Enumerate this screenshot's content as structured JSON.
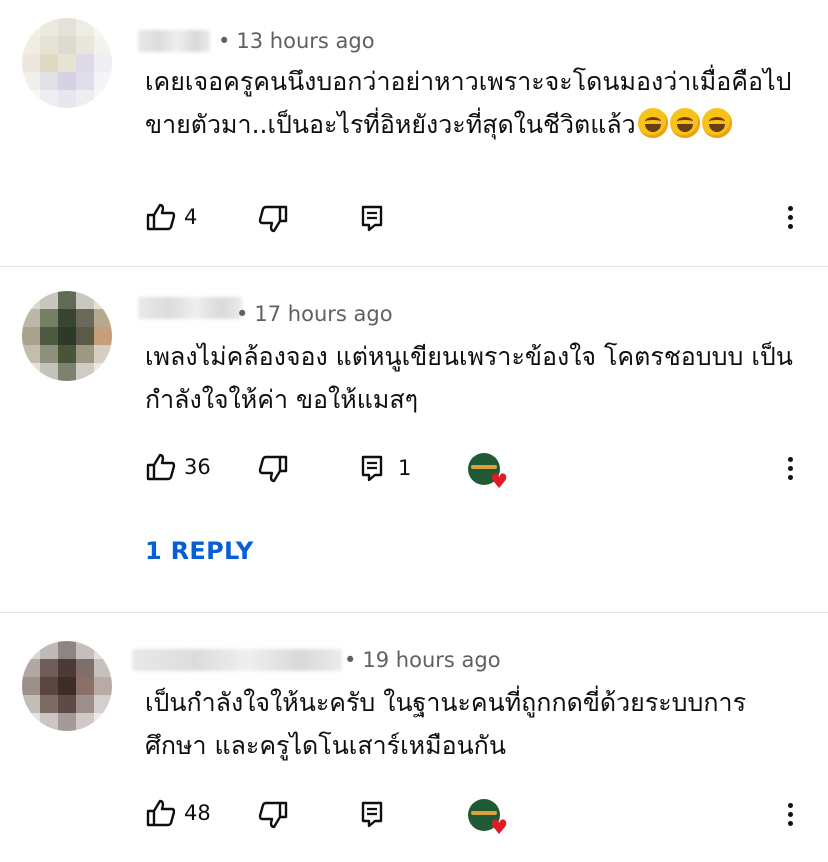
{
  "comments": [
    {
      "time": "13 hours ago",
      "text": "เคยเจอครูคนนึงบอกว่าอย่าหาวเพราะจะโดนมองว่าเมื่อคือไปขายตัวมา..เป็นอะไรที่อิหยังวะที่สุดในชีวิตแล้ว",
      "emojis": [
        "rofl-emoji",
        "rofl-emoji",
        "rofl-emoji"
      ],
      "likes": "4",
      "replies": "",
      "has_creator_heart": false
    },
    {
      "time": "17 hours ago",
      "text": "เพลงไม่คล้องจอง แต่หนูเขียนเพราะข้องใจ โคตรชอบบบ เป็นกำลังใจให้ค่า ขอให้แมสๆ",
      "likes": "36",
      "replies": "1",
      "has_creator_heart": true,
      "reply_link": "1 REPLY"
    },
    {
      "time": "19 hours ago",
      "text": "เป็นกำลังใจให้นะครับ ในฐานะคนที่ถูกกดขี่ด้วยระบบการศึกษา และครูไดโนเสาร์เหมือนกัน",
      "likes": "48",
      "replies": "",
      "has_creator_heart": true
    }
  ],
  "icons": {
    "like": "thumbs-up-icon",
    "dislike": "thumbs-down-icon",
    "reply": "reply-comment-icon",
    "more": "more-vert-icon",
    "heart": "creator-heart-icon"
  },
  "colors": {
    "link": "#065fd4",
    "meta": "#606060",
    "heart": "#e01b24"
  }
}
